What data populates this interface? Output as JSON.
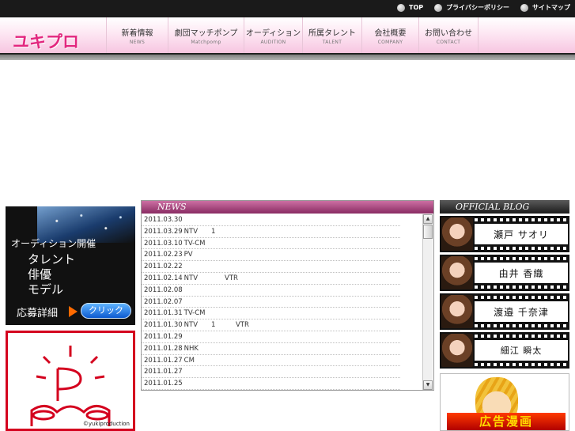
{
  "toplinks": [
    {
      "label": "TOP"
    },
    {
      "label": "プライバシーポリシー"
    },
    {
      "label": "サイトマップ"
    }
  ],
  "logo": "ユキプロ",
  "nav": [
    {
      "jp": "新着情報",
      "en": "NEWS"
    },
    {
      "jp": "劇団マッチポンプ",
      "en": "Matchpomp"
    },
    {
      "jp": "オーディション",
      "en": "AUDITION"
    },
    {
      "jp": "所属タレント",
      "en": "TALENT"
    },
    {
      "jp": "会社概要",
      "en": "COMPANY"
    },
    {
      "jp": "お問い合わせ",
      "en": "CONTACT"
    }
  ],
  "audition": {
    "title": "オーディション開催",
    "list": [
      "タレント",
      "俳優",
      "モデル"
    ],
    "apply": "応募詳細",
    "click": "クリック"
  },
  "pm_logo": {
    "copyright": "©yukiproduction"
  },
  "news": {
    "heading": "NEWS",
    "items": [
      {
        "date": "2011.03.30",
        "text": ""
      },
      {
        "date": "2011.03.29",
        "text": "NTV　　1"
      },
      {
        "date": "2011.03.10",
        "text": "TV-CM"
      },
      {
        "date": "2011.02.23",
        "text": "PV"
      },
      {
        "date": "2011.02.22",
        "text": ""
      },
      {
        "date": "2011.02.14",
        "text": "NTV　　　　VTR"
      },
      {
        "date": "2011.02.08",
        "text": ""
      },
      {
        "date": "2011.02.07",
        "text": ""
      },
      {
        "date": "2011.01.31",
        "text": "TV-CM"
      },
      {
        "date": "2011.01.30",
        "text": "NTV　　1　　　VTR"
      },
      {
        "date": "2011.01.29",
        "text": ""
      },
      {
        "date": "2011.01.28",
        "text": "NHK"
      },
      {
        "date": "2011.01.27",
        "text": "CM"
      },
      {
        "date": "2011.01.27",
        "text": ""
      },
      {
        "date": "2011.01.25",
        "text": ""
      }
    ]
  },
  "blog": {
    "heading": "OFFICIAL BLOG",
    "items": [
      {
        "name": "瀬戸 サオリ"
      },
      {
        "name": "由井 香織"
      },
      {
        "name": "渡邉 千奈津"
      },
      {
        "name": "細江 瞬太"
      }
    ]
  },
  "manga_banner": {
    "title": "広告漫画"
  }
}
